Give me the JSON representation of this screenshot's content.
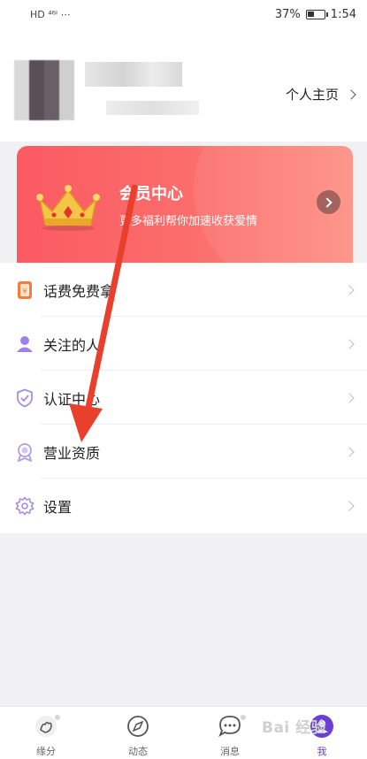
{
  "status_bar": {
    "left_icons": "HD ⁴⁶ᴵ ⋯",
    "battery": "37%",
    "battery_level": 0.37,
    "time": "1:54"
  },
  "profile": {
    "homepage_link": "个人主页"
  },
  "vip_card": {
    "title": "会员中心",
    "subtitle": "更多福利帮你加速收获爱情",
    "colors": {
      "start": "#fb5a62",
      "end": "#fd8f83"
    }
  },
  "menu": {
    "items": [
      {
        "label": "话费免费拿",
        "icon": "coupon-icon"
      },
      {
        "label": "关注的人",
        "icon": "person-icon"
      },
      {
        "label": "认证中心",
        "icon": "shield-check-icon"
      },
      {
        "label": "营业资质",
        "icon": "badge-icon"
      },
      {
        "label": "设置",
        "icon": "gear-icon"
      }
    ]
  },
  "bottom_nav": {
    "items": [
      {
        "label": "缘分",
        "icon": "hands-icon"
      },
      {
        "label": "动态",
        "icon": "compass-icon"
      },
      {
        "label": "消息",
        "icon": "chat-icon"
      },
      {
        "label": "我",
        "icon": "profile-icon",
        "active": true
      }
    ],
    "accent": "#6a3fd1"
  },
  "watermark": "Bai 经验"
}
